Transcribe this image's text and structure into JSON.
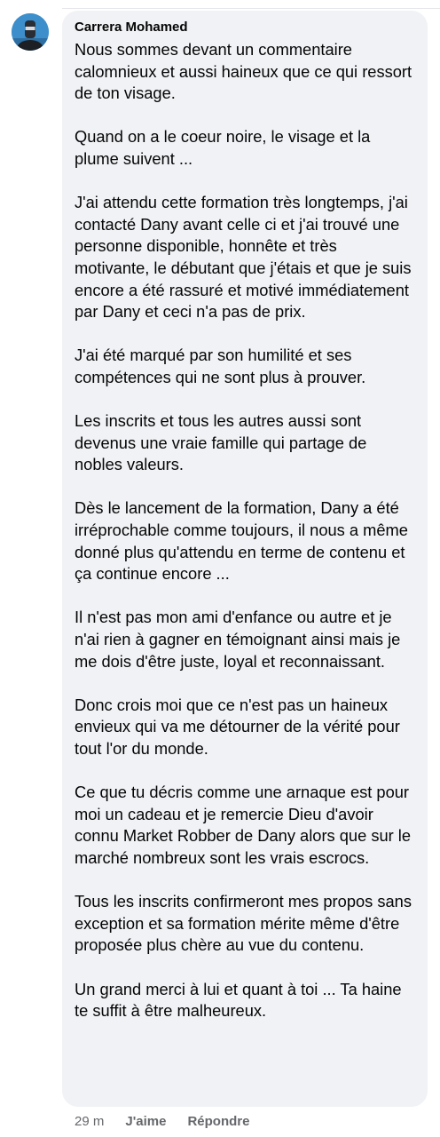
{
  "comment": {
    "author": "Carrera Mohamed",
    "paragraphs": [
      "Nous sommes devant un commentaire calomnieux et aussi haineux que ce qui ressort de ton visage.",
      "Quand on a le coeur noire, le visage et la plume suivent ...",
      "J'ai attendu cette formation très longtemps, j'ai contacté Dany avant celle ci et j'ai trouvé une personne disponible, honnête et très motivante, le débutant que j'étais et que je suis encore a été rassuré et motivé immédiatement par Dany et ceci n'a pas de prix.",
      "J'ai été marqué par son humilité et ses compétences qui ne sont plus à prouver.",
      "Les inscrits et tous les autres aussi sont devenus une vraie famille qui partage de nobles valeurs.",
      "Dès le lancement de la formation, Dany a été irréprochable comme toujours, il nous a même donné plus qu'attendu en terme de contenu et ça continue encore ...",
      "Il n'est pas mon ami d'enfance ou autre et je n'ai rien à gagner en témoignant ainsi mais je me dois d'être juste, loyal et reconnaissant.",
      "Donc crois moi que ce n'est pas un haineux envieux qui va me détourner de la vérité pour tout l'or du monde.",
      "Ce que tu décris comme une arnaque est pour moi un cadeau et je remercie Dieu d'avoir connu Market Robber de Dany alors que sur le marché nombreux sont les vrais escrocs.",
      "Tous les inscrits confirmeront mes propos sans exception et sa formation mérite même d'être proposée plus chère au vue du contenu.",
      "Un grand merci à lui et quant à toi ... Ta haine te suffit à être malheureux."
    ]
  },
  "actions": {
    "time": "29 m",
    "like_label": "J'aime",
    "reply_label": "Répondre"
  },
  "colors": {
    "bubble": "#f0f2f5",
    "text": "#050505",
    "meta": "#65676b",
    "avatar": "#3d8fcc"
  },
  "icons": {
    "avatar": "profile-avatar-icon",
    "watermark": "watermark-logo"
  }
}
